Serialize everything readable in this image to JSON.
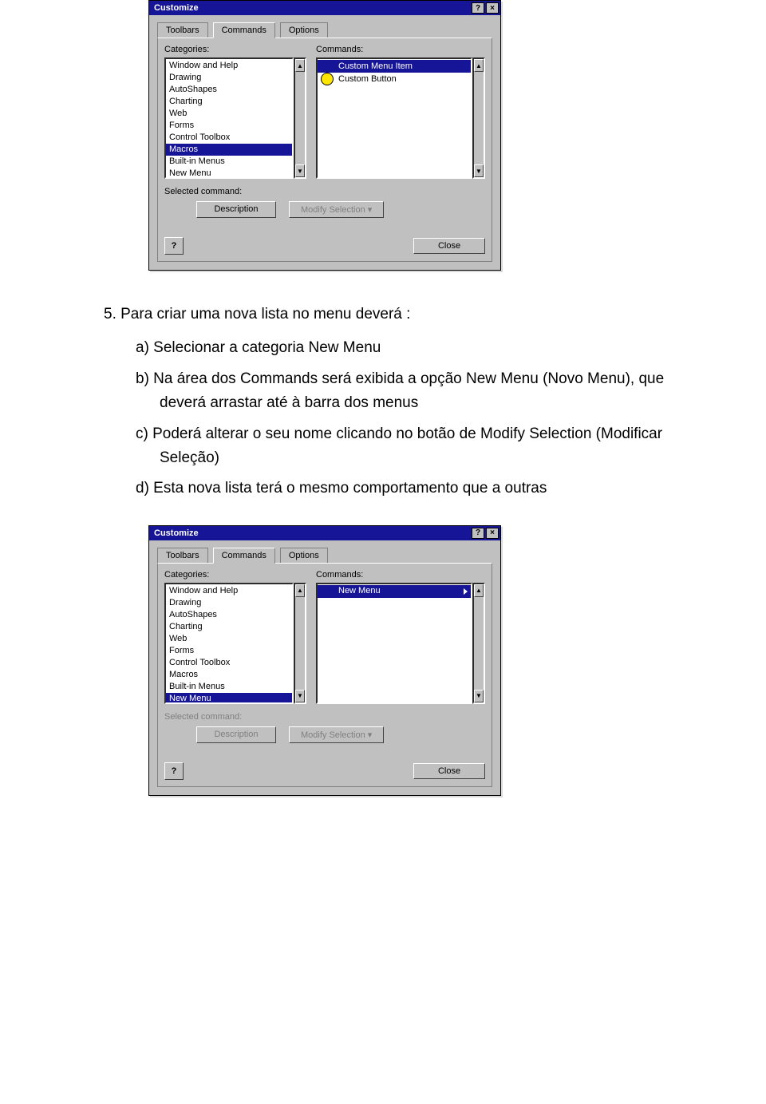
{
  "dialog1": {
    "title": "Customize",
    "tabs": {
      "toolbars": "Toolbars",
      "commands": "Commands",
      "options": "Options"
    },
    "labels": {
      "categories": "Categories:",
      "commands": "Commands:",
      "selected": "Selected command:"
    },
    "categories": [
      "Window and Help",
      "Drawing",
      "AutoShapes",
      "Charting",
      "Web",
      "Forms",
      "Control Toolbox",
      "Macros",
      "Built-in Menus",
      "New Menu"
    ],
    "categories_selected": 7,
    "commands": [
      {
        "label": "Custom Menu Item",
        "icon": "none"
      },
      {
        "label": "Custom Button",
        "icon": "smiley"
      }
    ],
    "commands_selected": 0,
    "buttons": {
      "description": "Description",
      "modify": "Modify Selection",
      "close": "Close"
    },
    "modify_disabled": true,
    "description_disabled": false
  },
  "doc": {
    "item5": "5.  Para criar uma nova lista no menu deverá :",
    "a": "a)  Selecionar a categoria New Menu",
    "b": "b)  Na área dos Commands será exibida a opção New Menu (Novo Menu), que deverá arrastar até à barra dos menus",
    "c": "c)  Poderá alterar o seu nome clicando no botão de Modify Selection (Modificar Seleção)",
    "d": "d)  Esta nova lista terá o mesmo comportamento que a outras"
  },
  "dialog2": {
    "title": "Customize",
    "tabs": {
      "toolbars": "Toolbars",
      "commands": "Commands",
      "options": "Options"
    },
    "labels": {
      "categories": "Categories:",
      "commands": "Commands:",
      "selected": "Selected command:"
    },
    "categories": [
      "Window and Help",
      "Drawing",
      "AutoShapes",
      "Charting",
      "Web",
      "Forms",
      "Control Toolbox",
      "Macros",
      "Built-in Menus",
      "New Menu"
    ],
    "categories_selected": 9,
    "commands": [
      {
        "label": "New Menu",
        "icon": "none",
        "submenu": true
      }
    ],
    "commands_selected": 0,
    "buttons": {
      "description": "Description",
      "modify": "Modify Selection",
      "close": "Close"
    },
    "modify_disabled": true,
    "description_disabled": true,
    "selected_label_disabled": true
  }
}
